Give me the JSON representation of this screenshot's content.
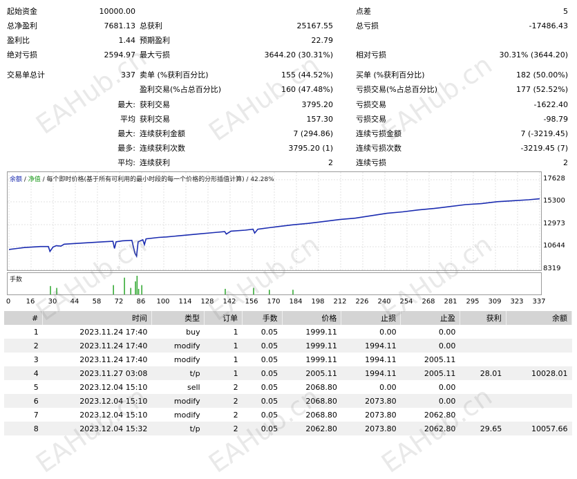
{
  "stats": [
    {
      "label": "起始资金",
      "value": "10000.00"
    },
    {
      "label": "点差",
      "value": "5"
    },
    {
      "label": "总净盈利",
      "value": "7681.13"
    },
    {
      "label": "总获利",
      "value": "25167.55"
    },
    {
      "label": "总亏损",
      "value": "-17486.43"
    },
    {
      "label": "盈利比",
      "value": "1.44"
    },
    {
      "label": "预期盈利",
      "value": "22.79"
    },
    {
      "label": "绝对亏损",
      "value": "2594.97"
    },
    {
      "label": "最大亏损",
      "value": "3644.20 (30.31%)"
    },
    {
      "label": "相对亏损",
      "value": "30.31% (3644.20)"
    },
    {
      "label": "交易单总计",
      "value": "337"
    },
    {
      "label": "卖单 (%获利百分比)",
      "value": "155 (44.52%)"
    },
    {
      "label": "买单 (%获利百分比)",
      "value": "182 (50.00%)"
    },
    {
      "label": "盈利交易(%占总百分比)",
      "value": "160 (47.48%)"
    },
    {
      "label": "亏损交易(%占总百分比)",
      "value": "177 (52.52%)"
    },
    {
      "prefix": "最大:",
      "label": "获利交易",
      "value": "3795.20"
    },
    {
      "label": "亏损交易",
      "value": "-1622.40"
    },
    {
      "prefix": "平均",
      "label": "获利交易",
      "value": "157.30"
    },
    {
      "label": "亏损交易",
      "value": "-98.79"
    },
    {
      "prefix": "最大:",
      "label": "连续获利金额",
      "value": "7 (294.86)"
    },
    {
      "label": "连续亏损金额",
      "value": "7 (-3219.45)"
    },
    {
      "prefix": "最多:",
      "label": "连续获利次数",
      "value": "3795.20 (1)"
    },
    {
      "label": "连续亏损次数",
      "value": "-3219.45 (7)"
    },
    {
      "prefix": "平均:",
      "label": "连续获利",
      "value": "2"
    },
    {
      "label": "连续亏损",
      "value": "2"
    }
  ],
  "chart": {
    "legend": {
      "balance": "余额",
      "sep1": " / ",
      "equity": "净值",
      "sep2": " / 每个即时价格(基于所有可利用的最小时段的每一个价格的分形插值计算) / 42.28%"
    },
    "volume_label": "手数",
    "y_ticks": [
      "17628",
      "15300",
      "12973",
      "10644",
      "8319"
    ],
    "x_ticks": [
      "0",
      "16",
      "30",
      "44",
      "58",
      "72",
      "86",
      "100",
      "114",
      "128",
      "142",
      "156",
      "170",
      "184",
      "198",
      "212",
      "226",
      "240",
      "254",
      "268",
      "281",
      "295",
      "309",
      "323",
      "337"
    ],
    "colors": {
      "balance": "#1a2bb0",
      "volume": "#2aa52a"
    },
    "balance_points": [
      [
        0,
        10400
      ],
      [
        5,
        10500
      ],
      [
        10,
        10600
      ],
      [
        20,
        10700
      ],
      [
        25,
        10700
      ],
      [
        26,
        10200
      ],
      [
        28,
        10650
      ],
      [
        30,
        10800
      ],
      [
        33,
        10750
      ],
      [
        35,
        10950
      ],
      [
        40,
        11000
      ],
      [
        50,
        11100
      ],
      [
        60,
        11200
      ],
      [
        66,
        11250
      ],
      [
        67,
        10500
      ],
      [
        68,
        11200
      ],
      [
        72,
        11300
      ],
      [
        78,
        11350
      ],
      [
        80,
        10000
      ],
      [
        81,
        9700
      ],
      [
        82,
        11200
      ],
      [
        85,
        11400
      ],
      [
        86,
        10900
      ],
      [
        87,
        11500
      ],
      [
        95,
        11650
      ],
      [
        100,
        11700
      ],
      [
        110,
        11850
      ],
      [
        120,
        12000
      ],
      [
        130,
        12150
      ],
      [
        137,
        12250
      ],
      [
        138,
        12000
      ],
      [
        141,
        12300
      ],
      [
        150,
        12400
      ],
      [
        155,
        12500
      ],
      [
        156,
        12100
      ],
      [
        158,
        12500
      ],
      [
        165,
        12650
      ],
      [
        170,
        12750
      ],
      [
        180,
        12950
      ],
      [
        190,
        13100
      ],
      [
        200,
        13300
      ],
      [
        210,
        13500
      ],
      [
        220,
        13650
      ],
      [
        230,
        13900
      ],
      [
        240,
        14150
      ],
      [
        250,
        14300
      ],
      [
        260,
        14500
      ],
      [
        270,
        14650
      ],
      [
        280,
        14850
      ],
      [
        290,
        15050
      ],
      [
        300,
        15150
      ],
      [
        310,
        15350
      ],
      [
        320,
        15450
      ],
      [
        330,
        15550
      ],
      [
        337,
        15650
      ]
    ],
    "y_range": [
      8319,
      17628
    ],
    "x_range": [
      0,
      337
    ],
    "volume_bars": [
      [
        26,
        0.45
      ],
      [
        30,
        0.35
      ],
      [
        66,
        0.5
      ],
      [
        73,
        0.9
      ],
      [
        77,
        0.35
      ],
      [
        80,
        0.7
      ],
      [
        81,
        1.0
      ],
      [
        82,
        0.3
      ],
      [
        84,
        0.5
      ],
      [
        137,
        0.3
      ],
      [
        155,
        0.35
      ],
      [
        165,
        0.25
      ],
      [
        180,
        0.25
      ]
    ]
  },
  "trades": {
    "headers": [
      "#",
      "时间",
      "类型",
      "订单",
      "手数",
      "价格",
      "止损",
      "止盈",
      "获利",
      "余额"
    ],
    "rows": [
      [
        "1",
        "2023.11.24 17:40",
        "buy",
        "1",
        "0.05",
        "1999.11",
        "0.00",
        "0.00",
        "",
        ""
      ],
      [
        "2",
        "2023.11.24 17:40",
        "modify",
        "1",
        "0.05",
        "1999.11",
        "1994.11",
        "0.00",
        "",
        ""
      ],
      [
        "3",
        "2023.11.24 17:40",
        "modify",
        "1",
        "0.05",
        "1999.11",
        "1994.11",
        "2005.11",
        "",
        ""
      ],
      [
        "4",
        "2023.11.27 03:08",
        "t/p",
        "1",
        "0.05",
        "2005.11",
        "1994.11",
        "2005.11",
        "28.01",
        "10028.01"
      ],
      [
        "5",
        "2023.12.04 15:10",
        "sell",
        "2",
        "0.05",
        "2068.80",
        "0.00",
        "0.00",
        "",
        ""
      ],
      [
        "6",
        "2023.12.04 15:10",
        "modify",
        "2",
        "0.05",
        "2068.80",
        "2073.80",
        "0.00",
        "",
        ""
      ],
      [
        "7",
        "2023.12.04 15:10",
        "modify",
        "2",
        "0.05",
        "2068.80",
        "2073.80",
        "2062.80",
        "",
        ""
      ],
      [
        "8",
        "2023.12.04 15:32",
        "t/p",
        "2",
        "0.05",
        "2062.80",
        "2073.80",
        "2062.80",
        "29.65",
        "10057.66"
      ]
    ]
  },
  "watermark": "EAHub.cn"
}
